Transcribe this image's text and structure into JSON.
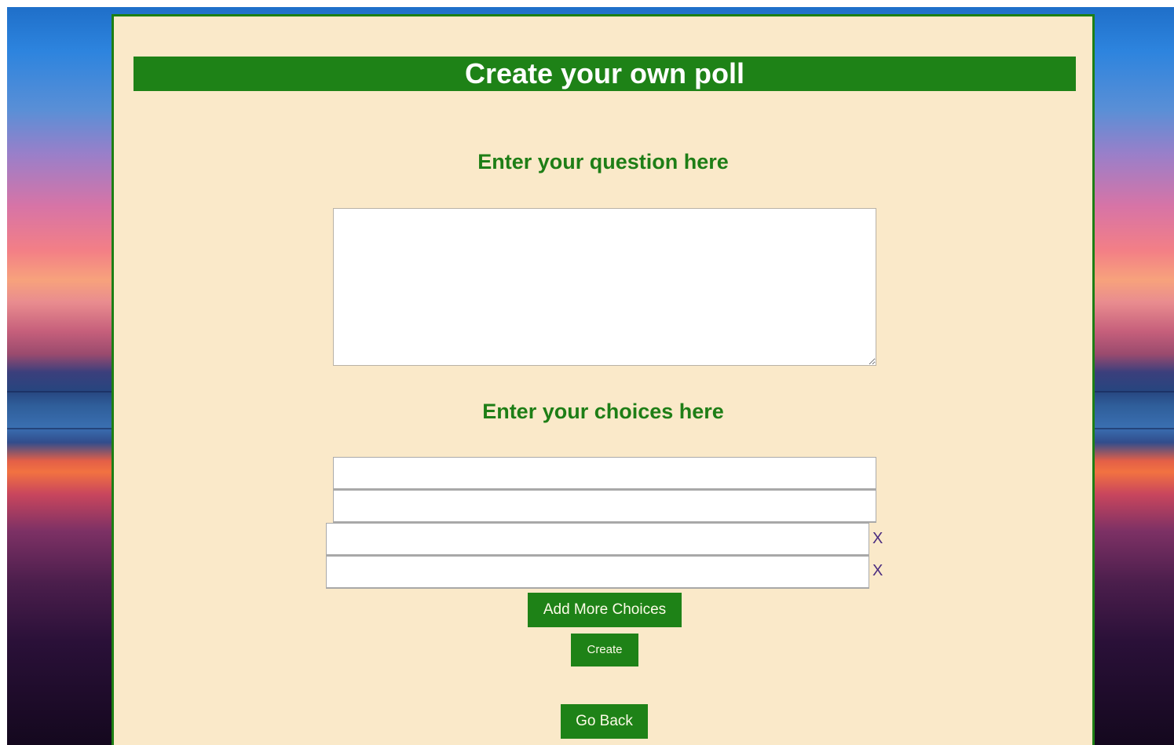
{
  "page": {
    "title": "Create your own poll",
    "question_heading": "Enter your question here",
    "choices_heading": "Enter your choices here"
  },
  "question": {
    "value": "",
    "placeholder": ""
  },
  "choices": [
    {
      "value": "",
      "removable": false
    },
    {
      "value": "",
      "removable": false
    },
    {
      "value": "",
      "removable": true
    },
    {
      "value": "",
      "removable": true
    }
  ],
  "remove_label": "X",
  "buttons": {
    "add_more": "Add More Choices",
    "create": "Create",
    "go_back": "Go Back"
  },
  "colors": {
    "accent_green": "#1e8217",
    "panel_background": "#fae9c9",
    "remove_x": "#4b2c7f"
  }
}
